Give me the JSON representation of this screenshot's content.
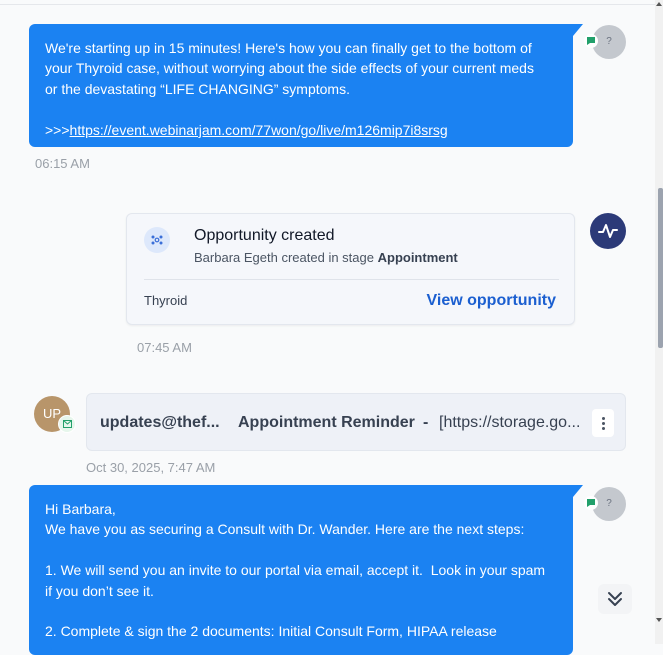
{
  "messages": [
    {
      "line1": "We're starting up in 15 minutes! Here's how you can finally get to the bottom of",
      "line2": "your Thyroid case, without worrying about the side effects of your current meds",
      "line3": "or the devastating “LIFE CHANGING” symptoms.",
      "link_prefix": ">>>",
      "link": "https://event.webinarjam.com/77won/go/live/m126mip7i8srsg",
      "time": "06:15 AM",
      "avatar_text": "?"
    },
    {
      "line1": "Hi Barbara,",
      "line2": "We have you as securing a Consult with Dr. Wander. Here are the next steps:",
      "line3": "1. We will send you an invite to our portal via email, accept it.  Look in your spam",
      "line4": "if you don’t see it.",
      "line5": "2. Complete & sign the 2 documents: Initial Consult Form, HIPAA release",
      "avatar_text": "?"
    }
  ],
  "opportunity": {
    "title": "Opportunity created",
    "actor": "Barbara Egeth",
    "action": "created in stage",
    "stage": "Appointment",
    "tag": "Thyroid",
    "link_label": "View opportunity",
    "time": "07:45 AM"
  },
  "email": {
    "avatar_initials": "UP",
    "from": "updates@thef...",
    "subject": "Appointment Reminder",
    "separator": "-",
    "preview": "[https://storage.go...",
    "time": "Oct 30, 2025, 7:47 AM"
  },
  "colors": {
    "bubble": "#1b82f2",
    "activity_avatar": "#2c3a78",
    "link": "#1b5fd0"
  },
  "icons": [
    "chat-icon",
    "opportunity-icon",
    "activity-icon",
    "email-icon",
    "more-vertical-icon",
    "chevron-double-down-icon"
  ]
}
